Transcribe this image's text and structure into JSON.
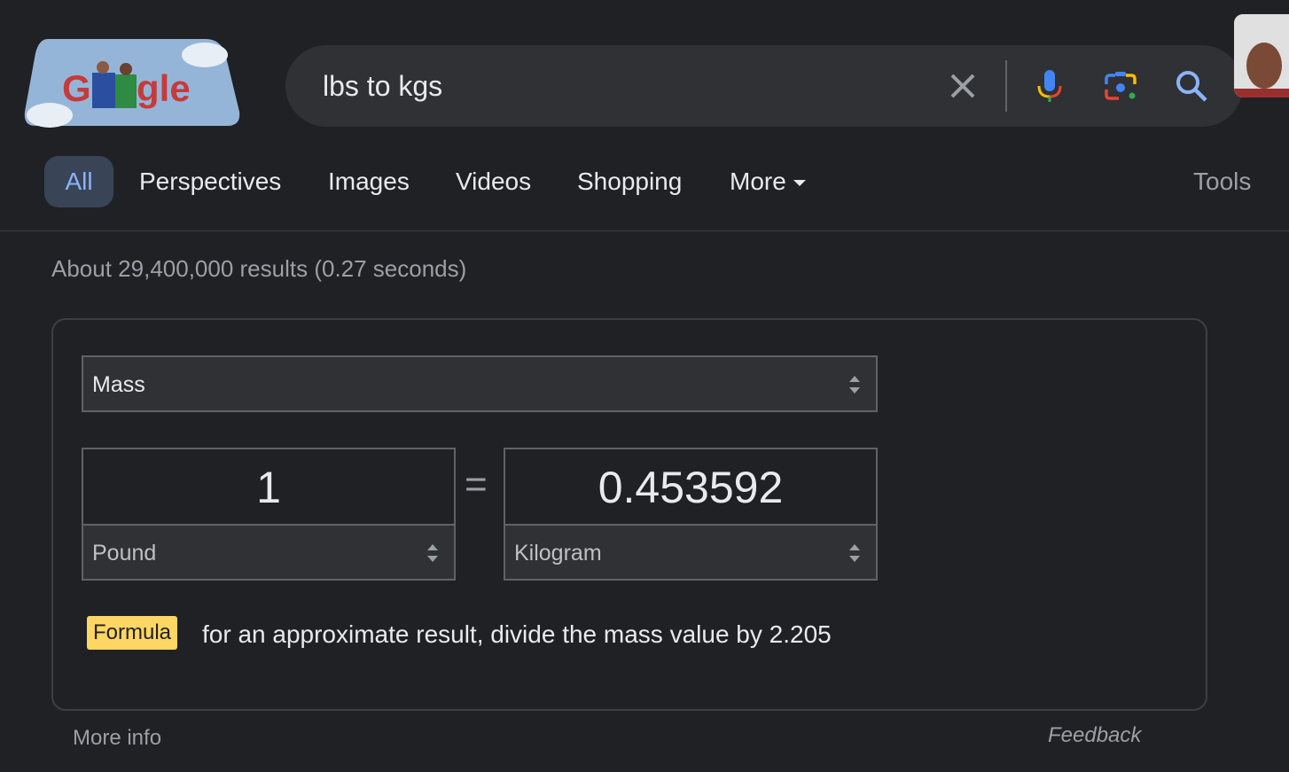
{
  "logo": {
    "text": "Google",
    "alt": "Google Doodle"
  },
  "search": {
    "query": "lbs to kgs",
    "icons": [
      "close-icon",
      "microphone-icon",
      "camera-lens-icon",
      "search-icon"
    ]
  },
  "tabs": [
    {
      "label": "All",
      "active": true
    },
    {
      "label": "Perspectives"
    },
    {
      "label": "Images"
    },
    {
      "label": "Videos"
    },
    {
      "label": "Shopping"
    },
    {
      "label": "More"
    }
  ],
  "tools_label": "Tools",
  "result_stats": "About 29,400,000 results (0.27 seconds)",
  "converter": {
    "category": "Mass",
    "from_value": "1",
    "from_unit": "Pound",
    "equals": "=",
    "to_value": "0.453592",
    "to_unit": "Kilogram",
    "formula_label": "Formula",
    "formula_text": "for an approximate result, divide the mass value by 2.205"
  },
  "more_info": "More info",
  "feedback": "Feedback",
  "colors": {
    "background": "#202124",
    "search_bar": "#303134",
    "active_tab": "#394457",
    "accent": "#8ab4f8",
    "formula_badge": "#fdd663"
  }
}
